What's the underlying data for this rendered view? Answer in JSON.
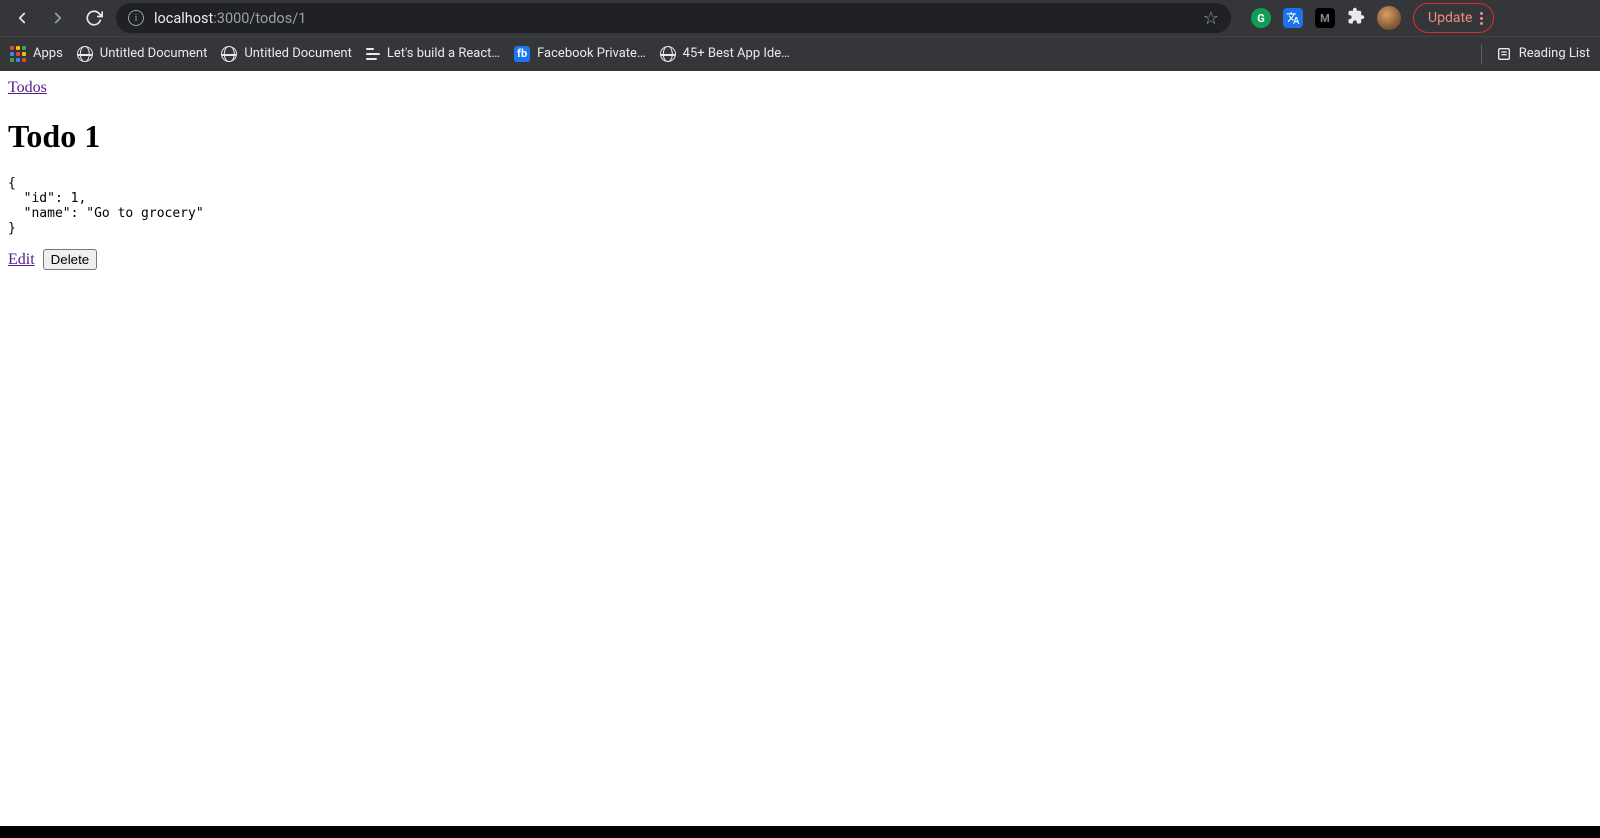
{
  "browser": {
    "address": {
      "host": "localhost",
      "path": ":3000/todos/1"
    },
    "update_label": "Update",
    "bookmarks": {
      "apps": "Apps",
      "items": [
        {
          "label": "Untitled Document",
          "icon": "globe"
        },
        {
          "label": "Untitled Document",
          "icon": "globe"
        },
        {
          "label": "Let's build a React…",
          "icon": "list"
        },
        {
          "label": "Facebook Private…",
          "icon": "fb"
        },
        {
          "label": "45+ Best App Ide…",
          "icon": "globe"
        }
      ],
      "reading_list": "Reading List"
    }
  },
  "page": {
    "breadcrumb_link": "Todos",
    "heading": "Todo 1",
    "json_dump": "{\n  \"id\": 1,\n  \"name\": \"Go to grocery\"\n}",
    "edit_label": "Edit",
    "delete_label": "Delete"
  }
}
